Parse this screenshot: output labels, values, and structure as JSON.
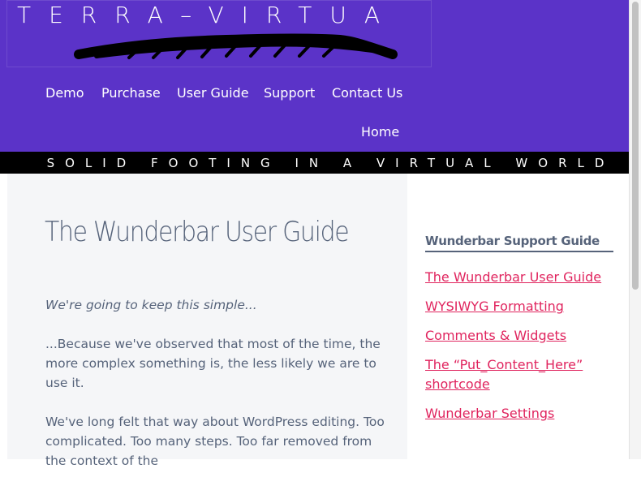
{
  "header": {
    "logo_text": "TERRA–VIRTUA",
    "nav": [
      "Demo",
      "Purchase",
      "User Guide",
      "Support",
      "Contact Us",
      "Home"
    ],
    "tagline": "SOLID FOOTING IN A VIRTUAL WORLD"
  },
  "main": {
    "title": "The Wunderbar User Guide",
    "paragraphs": [
      "We're going to keep this simple...",
      "...Because we've observed that most of the time, the more complex something is, the less likely we are to use it.",
      "We've long felt that way about WordPress editing. Too complicated. Too many steps. Too far removed from the context of the"
    ]
  },
  "sidebar": {
    "title": "Wunderbar Support Guide",
    "links": [
      "The Wunderbar User Guide",
      "WYSIWYG Formatting",
      "Comments & Widgets",
      "The “Put_Content_Here” shortcode",
      "Wunderbar Settings"
    ]
  },
  "colors": {
    "header_bg": "#5b33c8",
    "link": "#e0245e",
    "text": "#56637a"
  }
}
